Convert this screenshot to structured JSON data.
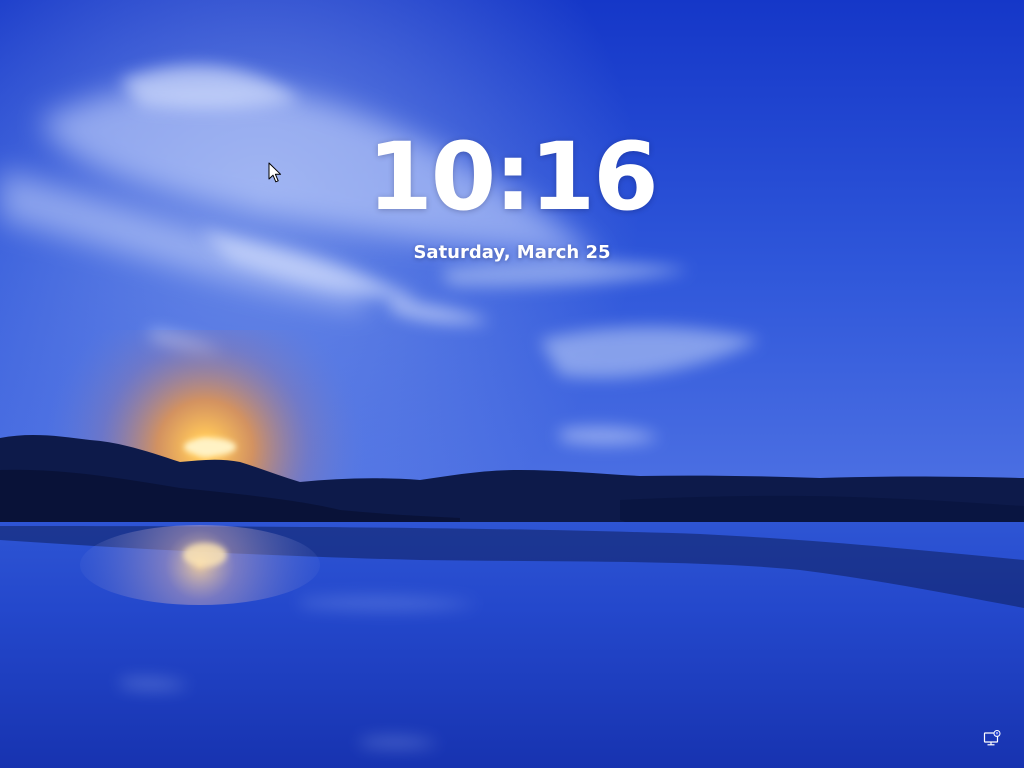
{
  "lockscreen": {
    "time": "10:16",
    "date": "Saturday, March 25"
  },
  "icons": {
    "network": "network-icon",
    "cursor": "mouse-pointer-icon"
  },
  "colors": {
    "sky_top": "#1a3fd6",
    "sky_mid": "#3a63e0",
    "horizon_glow": "#f0a14a",
    "mountains": "#0b1640",
    "water": "#1b3cc4",
    "text": "#ffffff"
  }
}
